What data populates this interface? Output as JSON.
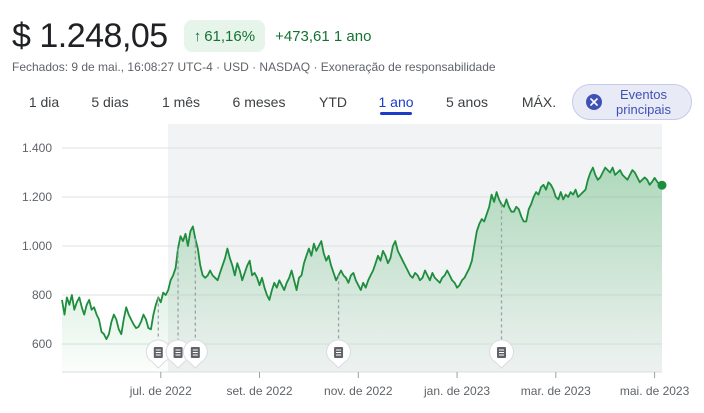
{
  "header": {
    "price": "$ 1.248,05",
    "pct_change": "61,16%",
    "abs_change": "+473,61 1 ano",
    "subline": "Fechados: 9 de mai., 16:08:27 UTC-4 · USD · NASDAQ · Exoneração de responsabilidade"
  },
  "tabs": [
    {
      "label": "1 dia",
      "active": false
    },
    {
      "label": "5 dias",
      "active": false
    },
    {
      "label": "1 mês",
      "active": false
    },
    {
      "label": "6 meses",
      "active": false
    },
    {
      "label": "YTD",
      "active": false
    },
    {
      "label": "1 ano",
      "active": true
    },
    {
      "label": "5 anos",
      "active": false
    },
    {
      "label": "MÁX.",
      "active": false
    }
  ],
  "events_button": {
    "line1": "Eventos",
    "line2": "principais"
  },
  "colors": {
    "line": "#1e8e3e",
    "fill": "#34a853",
    "active_tab": "#1a3cc8",
    "positive": "#137333"
  },
  "icons": {
    "arrow": "arrow-up-icon",
    "close": "close-icon",
    "event": "document-icon"
  },
  "chart_data": {
    "type": "area",
    "ylim": [
      500,
      1450
    ],
    "y_ticks": [
      {
        "value": 600,
        "label": "600"
      },
      {
        "value": 800,
        "label": "800"
      },
      {
        "value": 1000,
        "label": "1.000"
      },
      {
        "value": 1200,
        "label": "1.200"
      },
      {
        "value": 1400,
        "label": "1.400"
      }
    ],
    "x_ticks": [
      {
        "month": 2,
        "label": "jul. de 2022"
      },
      {
        "month": 4,
        "label": "set. de 2022"
      },
      {
        "month": 6,
        "label": "nov. de 2022"
      },
      {
        "month": 8,
        "label": "jan. de 2023"
      },
      {
        "month": 10,
        "label": "mar. de 2023"
      },
      {
        "month": 12,
        "label": "mai. de 2023"
      }
    ],
    "series": [
      {
        "values": [
          [
            0.0,
            780
          ],
          [
            0.05,
            720
          ],
          [
            0.1,
            790
          ],
          [
            0.15,
            760
          ],
          [
            0.2,
            800
          ],
          [
            0.25,
            740
          ],
          [
            0.3,
            770
          ],
          [
            0.35,
            790
          ],
          [
            0.4,
            750
          ],
          [
            0.45,
            720
          ],
          [
            0.5,
            760
          ],
          [
            0.55,
            780
          ],
          [
            0.6,
            740
          ],
          [
            0.65,
            750
          ],
          [
            0.7,
            720
          ],
          [
            0.75,
            700
          ],
          [
            0.8,
            650
          ],
          [
            0.85,
            640
          ],
          [
            0.9,
            620
          ],
          [
            0.95,
            640
          ],
          [
            1.0,
            690
          ],
          [
            1.05,
            720
          ],
          [
            1.1,
            700
          ],
          [
            1.15,
            660
          ],
          [
            1.2,
            640
          ],
          [
            1.25,
            700
          ],
          [
            1.3,
            750
          ],
          [
            1.35,
            720
          ],
          [
            1.4,
            700
          ],
          [
            1.45,
            680
          ],
          [
            1.5,
            665
          ],
          [
            1.55,
            670
          ],
          [
            1.6,
            690
          ],
          [
            1.65,
            720
          ],
          [
            1.7,
            700
          ],
          [
            1.75,
            665
          ],
          [
            1.8,
            660
          ],
          [
            1.85,
            720
          ],
          [
            1.9,
            760
          ],
          [
            1.95,
            790
          ],
          [
            2.0,
            770
          ],
          [
            2.05,
            810
          ],
          [
            2.1,
            800
          ],
          [
            2.15,
            820
          ],
          [
            2.2,
            860
          ],
          [
            2.25,
            880
          ],
          [
            2.3,
            910
          ],
          [
            2.35,
            990
          ],
          [
            2.4,
            1040
          ],
          [
            2.45,
            1020
          ],
          [
            2.5,
            1050
          ],
          [
            2.55,
            1000
          ],
          [
            2.6,
            1060
          ],
          [
            2.65,
            1080
          ],
          [
            2.7,
            1030
          ],
          [
            2.75,
            990
          ],
          [
            2.8,
            920
          ],
          [
            2.85,
            880
          ],
          [
            2.9,
            870
          ],
          [
            2.95,
            880
          ],
          [
            3.0,
            900
          ],
          [
            3.05,
            880
          ],
          [
            3.1,
            870
          ],
          [
            3.15,
            860
          ],
          [
            3.2,
            890
          ],
          [
            3.25,
            920
          ],
          [
            3.3,
            950
          ],
          [
            3.35,
            990
          ],
          [
            3.4,
            950
          ],
          [
            3.45,
            920
          ],
          [
            3.5,
            880
          ],
          [
            3.55,
            930
          ],
          [
            3.6,
            900
          ],
          [
            3.65,
            860
          ],
          [
            3.7,
            890
          ],
          [
            3.75,
            920
          ],
          [
            3.8,
            940
          ],
          [
            3.85,
            880
          ],
          [
            3.9,
            890
          ],
          [
            3.95,
            870
          ],
          [
            4.0,
            840
          ],
          [
            4.05,
            870
          ],
          [
            4.1,
            830
          ],
          [
            4.15,
            800
          ],
          [
            4.2,
            780
          ],
          [
            4.25,
            820
          ],
          [
            4.3,
            850
          ],
          [
            4.35,
            830
          ],
          [
            4.4,
            860
          ],
          [
            4.45,
            840
          ],
          [
            4.5,
            820
          ],
          [
            4.55,
            850
          ],
          [
            4.6,
            870
          ],
          [
            4.65,
            900
          ],
          [
            4.7,
            860
          ],
          [
            4.75,
            820
          ],
          [
            4.8,
            870
          ],
          [
            4.85,
            880
          ],
          [
            4.9,
            930
          ],
          [
            4.95,
            960
          ],
          [
            5.0,
            990
          ],
          [
            5.05,
            960
          ],
          [
            5.1,
            1010
          ],
          [
            5.15,
            980
          ],
          [
            5.2,
            1000
          ],
          [
            5.25,
            1020
          ],
          [
            5.3,
            970
          ],
          [
            5.35,
            940
          ],
          [
            5.4,
            960
          ],
          [
            5.45,
            920
          ],
          [
            5.5,
            890
          ],
          [
            5.55,
            860
          ],
          [
            5.6,
            880
          ],
          [
            5.65,
            900
          ],
          [
            5.7,
            880
          ],
          [
            5.75,
            870
          ],
          [
            5.8,
            850
          ],
          [
            5.85,
            880
          ],
          [
            5.9,
            890
          ],
          [
            5.95,
            860
          ],
          [
            6.0,
            840
          ],
          [
            6.05,
            820
          ],
          [
            6.1,
            850
          ],
          [
            6.15,
            830
          ],
          [
            6.2,
            860
          ],
          [
            6.25,
            880
          ],
          [
            6.3,
            900
          ],
          [
            6.35,
            930
          ],
          [
            6.4,
            960
          ],
          [
            6.45,
            940
          ],
          [
            6.5,
            980
          ],
          [
            6.55,
            960
          ],
          [
            6.6,
            930
          ],
          [
            6.65,
            950
          ],
          [
            6.7,
            1000
          ],
          [
            6.75,
            1020
          ],
          [
            6.8,
            980
          ],
          [
            6.85,
            960
          ],
          [
            6.9,
            940
          ],
          [
            6.95,
            920
          ],
          [
            7.0,
            900
          ],
          [
            7.05,
            880
          ],
          [
            7.1,
            870
          ],
          [
            7.15,
            890
          ],
          [
            7.2,
            880
          ],
          [
            7.25,
            860
          ],
          [
            7.3,
            870
          ],
          [
            7.35,
            900
          ],
          [
            7.4,
            880
          ],
          [
            7.45,
            860
          ],
          [
            7.5,
            890
          ],
          [
            7.55,
            870
          ],
          [
            7.6,
            860
          ],
          [
            7.65,
            850
          ],
          [
            7.7,
            870
          ],
          [
            7.75,
            880
          ],
          [
            7.8,
            900
          ],
          [
            7.85,
            880
          ],
          [
            7.9,
            860
          ],
          [
            7.95,
            850
          ],
          [
            8.0,
            830
          ],
          [
            8.05,
            840
          ],
          [
            8.1,
            860
          ],
          [
            8.15,
            870
          ],
          [
            8.2,
            890
          ],
          [
            8.25,
            910
          ],
          [
            8.3,
            940
          ],
          [
            8.35,
            1000
          ],
          [
            8.4,
            1060
          ],
          [
            8.45,
            1090
          ],
          [
            8.5,
            1110
          ],
          [
            8.55,
            1100
          ],
          [
            8.6,
            1130
          ],
          [
            8.65,
            1160
          ],
          [
            8.7,
            1210
          ],
          [
            8.75,
            1180
          ],
          [
            8.8,
            1220
          ],
          [
            8.85,
            1190
          ],
          [
            8.9,
            1170
          ],
          [
            8.95,
            1160
          ],
          [
            9.0,
            1190
          ],
          [
            9.05,
            1160
          ],
          [
            9.1,
            1140
          ],
          [
            9.15,
            1140
          ],
          [
            9.2,
            1160
          ],
          [
            9.25,
            1150
          ],
          [
            9.3,
            1120
          ],
          [
            9.35,
            1100
          ],
          [
            9.4,
            1100
          ],
          [
            9.45,
            1150
          ],
          [
            9.5,
            1170
          ],
          [
            9.55,
            1200
          ],
          [
            9.6,
            1220
          ],
          [
            9.65,
            1210
          ],
          [
            9.7,
            1240
          ],
          [
            9.75,
            1250
          ],
          [
            9.8,
            1230
          ],
          [
            9.85,
            1260
          ],
          [
            9.9,
            1250
          ],
          [
            9.95,
            1230
          ],
          [
            10.0,
            1200
          ],
          [
            10.05,
            1190
          ],
          [
            10.1,
            1220
          ],
          [
            10.15,
            1190
          ],
          [
            10.2,
            1210
          ],
          [
            10.25,
            1200
          ],
          [
            10.3,
            1220
          ],
          [
            10.35,
            1210
          ],
          [
            10.4,
            1230
          ],
          [
            10.45,
            1200
          ],
          [
            10.5,
            1210
          ],
          [
            10.55,
            1220
          ],
          [
            10.6,
            1230
          ],
          [
            10.65,
            1270
          ],
          [
            10.7,
            1300
          ],
          [
            10.75,
            1320
          ],
          [
            10.8,
            1290
          ],
          [
            10.85,
            1270
          ],
          [
            10.9,
            1280
          ],
          [
            10.95,
            1300
          ],
          [
            11.0,
            1320
          ],
          [
            11.05,
            1310
          ],
          [
            11.1,
            1300
          ],
          [
            11.15,
            1320
          ],
          [
            11.2,
            1290
          ],
          [
            11.25,
            1300
          ],
          [
            11.3,
            1310
          ],
          [
            11.35,
            1290
          ],
          [
            11.4,
            1280
          ],
          [
            11.45,
            1270
          ],
          [
            11.5,
            1290
          ],
          [
            11.55,
            1310
          ],
          [
            11.6,
            1300
          ],
          [
            11.65,
            1280
          ],
          [
            11.7,
            1260
          ],
          [
            11.75,
            1270
          ],
          [
            11.8,
            1280
          ],
          [
            11.85,
            1270
          ],
          [
            11.9,
            1250
          ],
          [
            11.95,
            1262
          ],
          [
            12.0,
            1278
          ],
          [
            12.05,
            1263
          ],
          [
            12.1,
            1250
          ],
          [
            12.15,
            1248.05
          ]
        ]
      }
    ],
    "events": [
      {
        "month": 1.95
      },
      {
        "month": 2.35
      },
      {
        "month": 2.7
      },
      {
        "month": 5.6
      },
      {
        "month": 8.9
      }
    ]
  }
}
